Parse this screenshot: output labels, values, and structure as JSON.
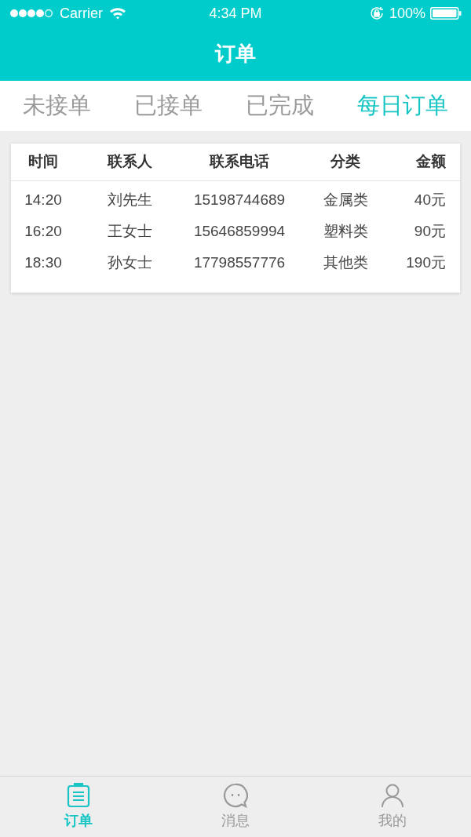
{
  "status_bar": {
    "carrier": "Carrier",
    "time": "4:34 PM",
    "battery": "100%"
  },
  "nav": {
    "title": "订单"
  },
  "tabs": [
    {
      "label": "未接单",
      "selected": false
    },
    {
      "label": "已接单",
      "selected": false
    },
    {
      "label": "已完成",
      "selected": false
    },
    {
      "label": "每日订单",
      "selected": true
    }
  ],
  "table": {
    "columns": [
      "时间",
      "联系人",
      "联系电话",
      "分类",
      "金额"
    ],
    "rows": [
      [
        "14:20",
        "刘先生",
        "15198744689",
        "金属类",
        "40元"
      ],
      [
        "16:20",
        "王女士",
        "15646859994",
        "塑料类",
        "90元"
      ],
      [
        "18:30",
        "孙女士",
        "17798557776",
        "其他类",
        "190元"
      ]
    ]
  },
  "tab_bar": [
    {
      "label": "订单",
      "kind": "orders",
      "selected": true
    },
    {
      "label": "消息",
      "kind": "messages",
      "selected": false
    },
    {
      "label": "我的",
      "kind": "profile",
      "selected": false
    }
  ]
}
